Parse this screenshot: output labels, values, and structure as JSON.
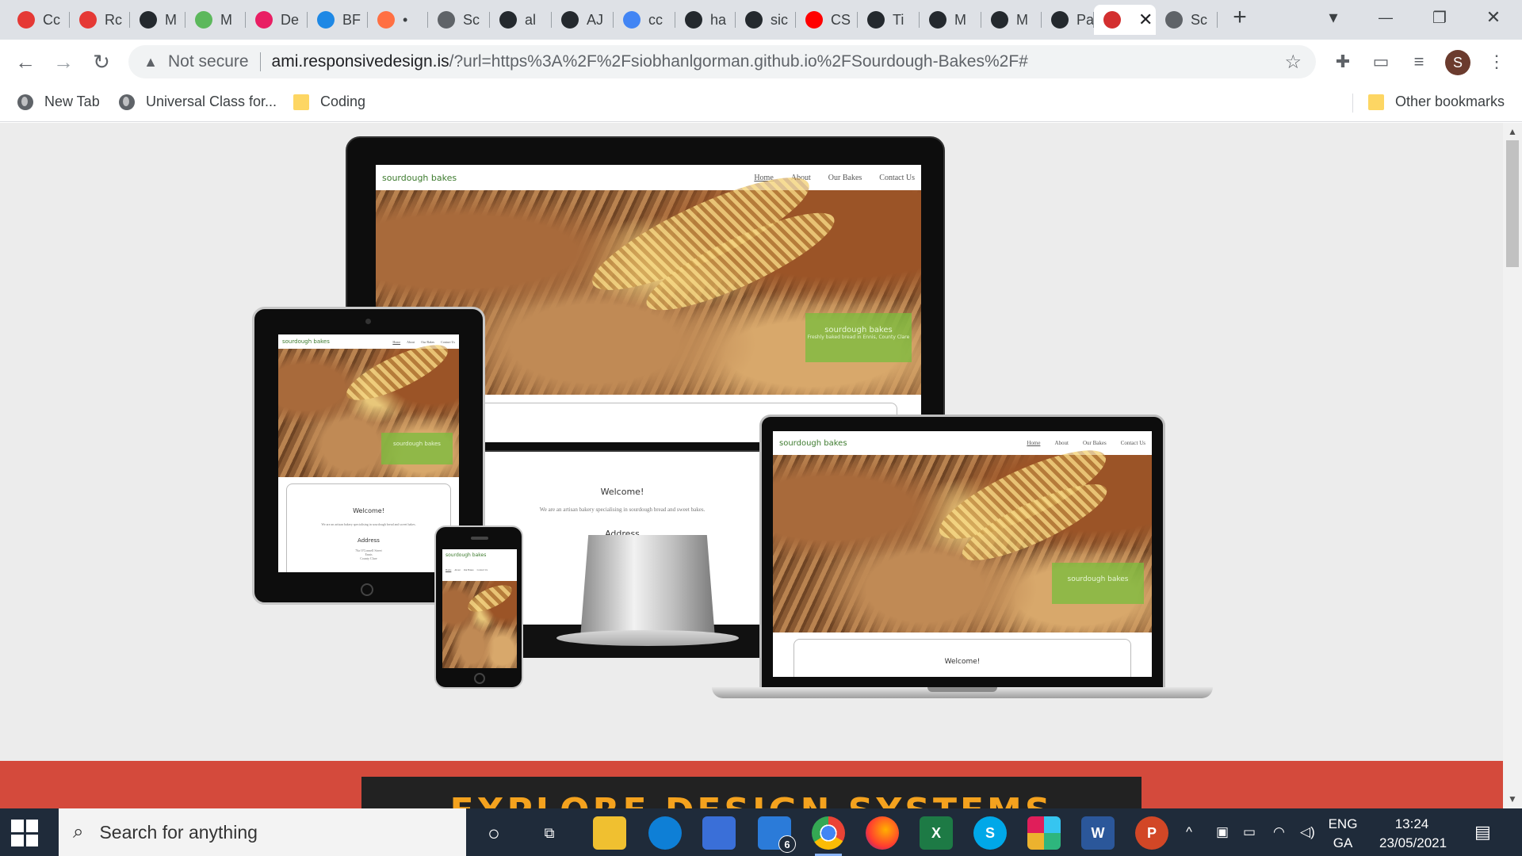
{
  "browser": {
    "tabs": [
      {
        "label": "Cc",
        "icon": "opera-icon",
        "color": "#e53935"
      },
      {
        "label": "Rc",
        "icon": "opera-icon",
        "color": "#e53935"
      },
      {
        "label": "M",
        "icon": "github-icon",
        "color": "#24292e"
      },
      {
        "label": "M",
        "icon": "stack-icon",
        "color": "#5cb85c"
      },
      {
        "label": "De",
        "icon": "dm-icon",
        "color": "#e91e63"
      },
      {
        "label": "BF",
        "icon": "sync-icon",
        "color": "#1e88e5"
      },
      {
        "label": "•",
        "icon": "g-icon",
        "color": "#ff7043"
      },
      {
        "label": "Sc",
        "icon": "globe-icon",
        "color": "#5f6368"
      },
      {
        "label": "al",
        "icon": "github-icon",
        "color": "#24292e"
      },
      {
        "label": "AJ",
        "icon": "github-icon",
        "color": "#24292e"
      },
      {
        "label": "cc",
        "icon": "google-icon",
        "color": "#4285f4"
      },
      {
        "label": "ha",
        "icon": "github-icon",
        "color": "#24292e"
      },
      {
        "label": "sic",
        "icon": "github-icon",
        "color": "#24292e"
      },
      {
        "label": "CS",
        "icon": "youtube-icon",
        "color": "#ff0000"
      },
      {
        "label": "Ti",
        "icon": "github-icon",
        "color": "#24292e"
      },
      {
        "label": "M",
        "icon": "github-icon",
        "color": "#24292e"
      },
      {
        "label": "M",
        "icon": "github-icon",
        "color": "#24292e"
      },
      {
        "label": "Pa",
        "icon": "github-icon",
        "color": "#24292e"
      },
      {
        "label": "",
        "icon": "ami-icon",
        "color": "#d32f2f",
        "active": true
      },
      {
        "label": "Sc",
        "icon": "globe-icon",
        "color": "#5f6368"
      }
    ],
    "new_tab": "+",
    "address": {
      "security": "Not secure",
      "host": "ami.responsivedesign.is",
      "path": "/?url=https%3A%2F%2Fsiobhanlgorman.github.io%2FSourdough-Bakes%2F#"
    },
    "profile_initial": "S",
    "bookmarks": [
      {
        "label": "New Tab",
        "icon": "globe-icon"
      },
      {
        "label": "Universal Class for...",
        "icon": "globe-icon"
      },
      {
        "label": "Coding",
        "icon": "folder-icon"
      }
    ],
    "other_bookmarks": "Other bookmarks"
  },
  "site": {
    "brand": "sourdough bakes",
    "nav": [
      "Home",
      "About",
      "Our Bakes",
      "Contact Us"
    ],
    "hero_title": "sourdough bakes",
    "hero_sub": "Freshly baked bread in Ennis, County Clare",
    "welcome_title": "Welcome!",
    "welcome_text": "We are an artisan bakery specialising in sourdough bread and sweet bakes.",
    "address_title": "Address",
    "address_lines": [
      "76a O'Connell Street",
      "Ennis",
      "County Clare"
    ]
  },
  "ad": {
    "text": "EXPLORE DESIGN SYSTEMS"
  },
  "taskbar": {
    "search_placeholder": "Search for anything",
    "mail_badge": "6",
    "lang_top": "ENG",
    "lang_bottom": "GA",
    "time": "13:24",
    "date": "23/05/2021"
  }
}
